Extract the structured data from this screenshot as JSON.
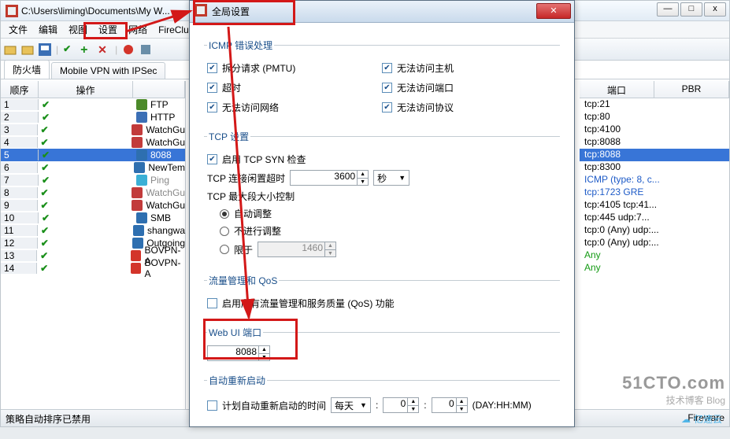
{
  "main": {
    "title_path": "C:\\Users\\liming\\Documents\\My W...",
    "menubar": [
      "文件",
      "编辑",
      "视图",
      "设置",
      "网络",
      "FireCluster"
    ],
    "win_buttons": {
      "min": "—",
      "max": "□",
      "close": "x"
    },
    "tabs": {
      "firewall": "防火墙",
      "vpn": "Mobile VPN with IPSec"
    },
    "table_head": {
      "seq": "顺序",
      "act": "操作"
    },
    "rows": [
      {
        "seq": "1",
        "svc": "FTP",
        "dim": false,
        "sel": false,
        "icon": "#4c8a2a"
      },
      {
        "seq": "2",
        "svc": "HTTP",
        "dim": false,
        "sel": false,
        "icon": "#3b6fb5"
      },
      {
        "seq": "3",
        "svc": "WatchGu",
        "dim": false,
        "sel": false,
        "icon": "#c23b3b"
      },
      {
        "seq": "4",
        "svc": "WatchGu",
        "dim": false,
        "sel": false,
        "icon": "#c23b3b"
      },
      {
        "seq": "5",
        "svc": "8088",
        "dim": false,
        "sel": true,
        "icon": "#2e6fb0"
      },
      {
        "seq": "6",
        "svc": "NewTem",
        "dim": false,
        "sel": false,
        "icon": "#2e6fb0"
      },
      {
        "seq": "7",
        "svc": "Ping",
        "dim": true,
        "sel": false,
        "icon": "#3bb0d6"
      },
      {
        "seq": "8",
        "svc": "WatchGu",
        "dim": true,
        "sel": false,
        "icon": "#c23b3b"
      },
      {
        "seq": "9",
        "svc": "WatchGu",
        "dim": false,
        "sel": false,
        "icon": "#c23b3b"
      },
      {
        "seq": "10",
        "svc": "SMB",
        "dim": false,
        "sel": false,
        "icon": "#2e6fb0"
      },
      {
        "seq": "11",
        "svc": "shangwa",
        "dim": false,
        "sel": false,
        "icon": "#2e6fb0"
      },
      {
        "seq": "12",
        "svc": "Outgoing",
        "dim": false,
        "sel": false,
        "icon": "#2e6fb0"
      },
      {
        "seq": "13",
        "svc": "BOVPN-A",
        "dim": false,
        "sel": false,
        "icon": "#d3342a"
      },
      {
        "seq": "14",
        "svc": "BOVPN-A",
        "dim": false,
        "sel": false,
        "icon": "#d3342a"
      }
    ],
    "right_head": {
      "port": "端口",
      "pbr": "PBR"
    },
    "ports": [
      {
        "t": "tcp:21",
        "cls": ""
      },
      {
        "t": "tcp:80",
        "cls": ""
      },
      {
        "t": "tcp:4100",
        "cls": ""
      },
      {
        "t": "tcp:8088",
        "cls": ""
      },
      {
        "t": "tcp:8088",
        "cls": "selected"
      },
      {
        "t": "tcp:8300",
        "cls": ""
      },
      {
        "t": "ICMP (type: 8, c...",
        "cls": "link"
      },
      {
        "t": "tcp:1723 GRE",
        "cls": "link"
      },
      {
        "t": "tcp:4105 tcp:41...",
        "cls": ""
      },
      {
        "t": "tcp:445 udp:7...",
        "cls": ""
      },
      {
        "t": "tcp:0 (Any) udp:...",
        "cls": ""
      },
      {
        "t": "tcp:0 (Any) udp:...",
        "cls": ""
      },
      {
        "t": "Any",
        "cls": "green"
      },
      {
        "t": "Any",
        "cls": "green"
      }
    ],
    "status_left": "策略自动排序已禁用",
    "status_right": "Fireware"
  },
  "dialog": {
    "title": "全局设置",
    "icmp": {
      "legend": "ICMP 错误处理",
      "items": {
        "pmtu": "拆分请求 (PMTU)",
        "host": "无法访问主机",
        "timeout": "超时",
        "port": "无法访问端口",
        "net": "无法访问网络",
        "proto": "无法访问协议"
      }
    },
    "tcp": {
      "legend": "TCP 设置",
      "syn": "启用 TCP SYN 检查",
      "idle_label": "TCP 连接闲置超时",
      "idle_val": "3600",
      "idle_unit": "秒",
      "mss_legend": "TCP 最大段大小控制",
      "auto": "自动调整",
      "none": "不进行调整",
      "limit": "限于",
      "limit_val": "1460"
    },
    "qos": {
      "legend": "流量管理和 QoS",
      "enable": "启用所有流量管理和服务质量 (QoS) 功能"
    },
    "webui": {
      "legend": "Web UI 端口",
      "val": "8088"
    },
    "reboot": {
      "legend": "自动重新启动",
      "enable": "计划自动重新启动的时间",
      "unit": "每天",
      "h": "0",
      "m": "0",
      "hint": "(DAY:HH:MM)"
    }
  },
  "watermark": {
    "big": "51CTO.com",
    "small": "技术博客   Blog",
    "cloud": "亿速云"
  }
}
